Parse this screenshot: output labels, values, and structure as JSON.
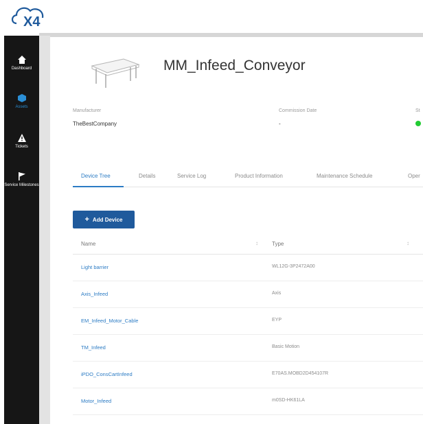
{
  "app": {
    "logo_text": "X4"
  },
  "sidebar": {
    "items": [
      {
        "label": "Dashboard",
        "icon": "home-icon"
      },
      {
        "label": "Assets",
        "icon": "cube-icon"
      },
      {
        "label": "Tickets",
        "icon": "warning-icon"
      },
      {
        "label": "Service Milestones",
        "icon": "flag-icon"
      }
    ],
    "active_color": "#2b8fd6"
  },
  "device": {
    "title": "MM_Infeed_Conveyor",
    "manufacturer_label": "Manufacturer",
    "manufacturer_value": "TheBestCompany",
    "commission_label": "Commission Date",
    "commission_value": "-",
    "status_label": "St"
  },
  "tabs": [
    "Device Tree",
    "Details",
    "Service Log",
    "Product Information",
    "Maintenance Schedule",
    "Oper"
  ],
  "actions": {
    "add_device": "Add Device"
  },
  "table": {
    "columns": [
      "Name",
      "Type"
    ],
    "rows": [
      {
        "name": "Light barrier",
        "type": "WL12G-3P2472A00"
      },
      {
        "name": "Axis_Infeed",
        "type": "Axis"
      },
      {
        "name": "EM_Infeed_Motor_Cable",
        "type": "EYP"
      },
      {
        "name": "TM_Infeed",
        "type": "Basic Motion"
      },
      {
        "name": "iPDO_ConsCartInfeed",
        "type": "E70AS.MOBD2D454107R"
      },
      {
        "name": "Motor_Infeed",
        "type": "m0SD-HK61LA"
      }
    ]
  },
  "colors": {
    "accent": "#2b7bc4",
    "button": "#1f5a9c",
    "sidebar": "#161616",
    "status_ok": "#22cc33"
  }
}
